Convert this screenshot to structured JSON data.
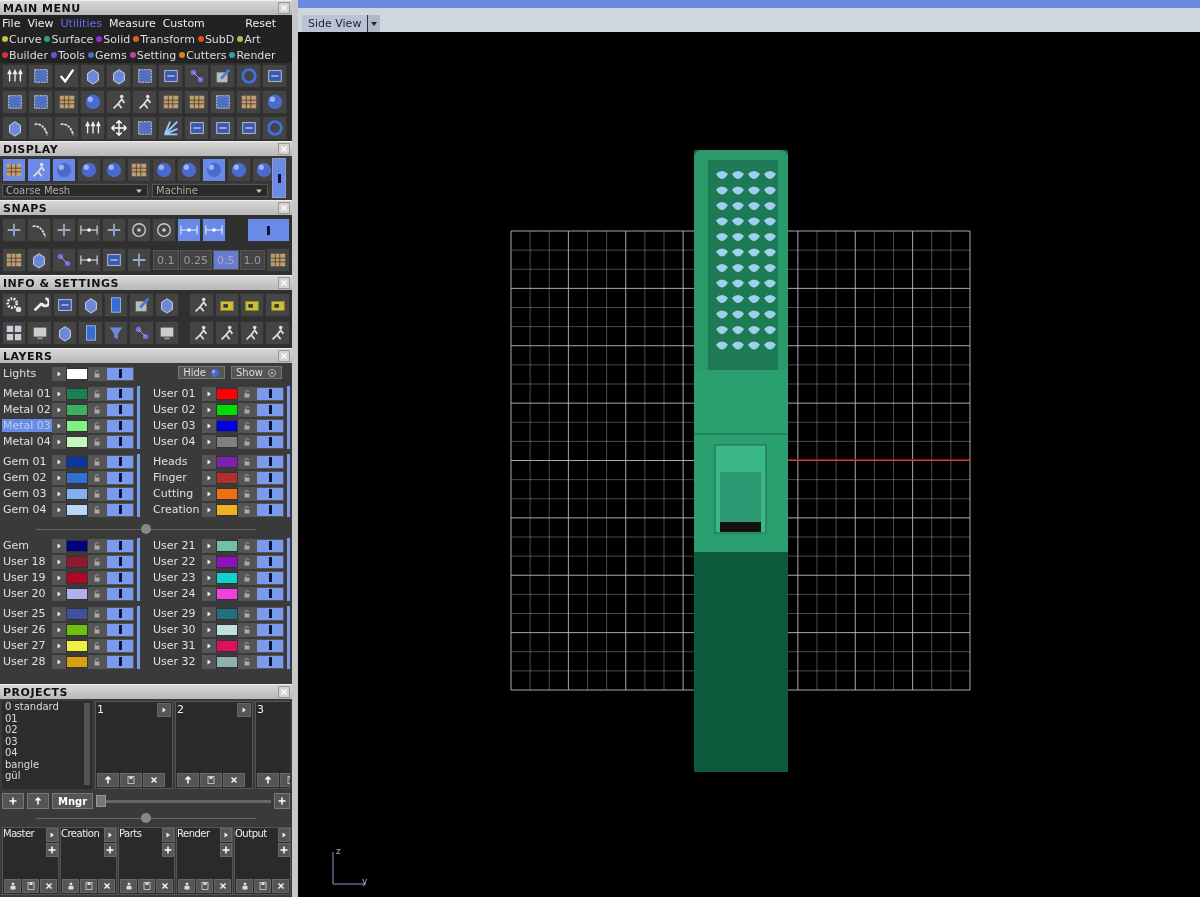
{
  "main_menu": {
    "title": "MAIN MENU",
    "menu": [
      {
        "label": "File",
        "selected": false
      },
      {
        "label": "View",
        "selected": false
      },
      {
        "label": "Utilities",
        "selected": true
      },
      {
        "label": "Measure",
        "selected": false
      },
      {
        "label": "Custom",
        "selected": false
      }
    ],
    "reset": "Reset",
    "categories": [
      [
        {
          "label": "Curve",
          "color": "#c8c040"
        },
        {
          "label": "Surface",
          "color": "#30a070"
        },
        {
          "label": "Solid",
          "color": "#9030d0"
        },
        {
          "label": "Transform",
          "color": "#e06020"
        },
        {
          "label": "SubD",
          "color": "#e05020"
        },
        {
          "label": "Art",
          "color": "#b0c040"
        }
      ],
      [
        {
          "label": "Builder",
          "color": "#d03040"
        },
        {
          "label": "Tools",
          "color": "#7050d0"
        },
        {
          "label": "Gems",
          "color": "#4070c0"
        },
        {
          "label": "Setting",
          "color": "#c040b0"
        },
        {
          "label": "Cutters",
          "color": "#e08020"
        },
        {
          "label": "Render",
          "color": "#30a0a0"
        }
      ]
    ]
  },
  "display": {
    "title": "DISPLAY",
    "mesh": "Coarse Mesh",
    "material": "Machine"
  },
  "snaps": {
    "title": "SNAPS",
    "toggles": [
      {
        "on": false
      },
      {
        "on": false
      },
      {
        "on": false
      },
      {
        "on": false
      },
      {
        "on": false
      },
      {
        "on": false
      },
      {
        "on": false
      },
      {
        "on": true
      },
      {
        "on": true
      }
    ],
    "increments": [
      {
        "label": "0.1",
        "selected": false
      },
      {
        "label": "0.25",
        "selected": false
      },
      {
        "label": "0.5",
        "selected": true
      },
      {
        "label": "1.0",
        "selected": false
      }
    ]
  },
  "info": {
    "title": "INFO & SETTINGS"
  },
  "layers": {
    "title": "LAYERS",
    "lights": {
      "name": "Lights",
      "color": "#ffffff",
      "selected": false,
      "visible": true
    },
    "hide": "Hide",
    "show": "Show",
    "sections": [
      [
        {
          "left": [
            {
              "name": "Metal 01",
              "color": "#1a8050",
              "selected": false,
              "visible": true
            },
            {
              "name": "Metal 02",
              "color": "#3cb060",
              "selected": false,
              "visible": true
            },
            {
              "name": "Metal 03",
              "color": "#80f080",
              "selected": true,
              "visible": true
            },
            {
              "name": "Metal 04",
              "color": "#c0f8c0",
              "selected": false,
              "visible": true
            }
          ],
          "right": [
            {
              "name": "User 01",
              "color": "#ff0000",
              "selected": false,
              "visible": true
            },
            {
              "name": "User 02",
              "color": "#00e000",
              "selected": false,
              "visible": true
            },
            {
              "name": "User 03",
              "color": "#0000e0",
              "selected": false,
              "visible": true
            },
            {
              "name": "User 04",
              "color": "#808080",
              "selected": false,
              "visible": true
            }
          ]
        },
        {
          "left": [
            {
              "name": "Gem 01",
              "color": "#0838a0",
              "selected": false,
              "visible": true
            },
            {
              "name": "Gem 02",
              "color": "#3070d0",
              "selected": false,
              "visible": true
            },
            {
              "name": "Gem 03",
              "color": "#80b0f0",
              "selected": false,
              "visible": true
            },
            {
              "name": "Gem 04",
              "color": "#b8d8f8",
              "selected": false,
              "visible": true
            }
          ],
          "right": [
            {
              "name": "Heads",
              "color": "#8020b0",
              "selected": false,
              "visible": true
            },
            {
              "name": "Finger",
              "color": "#b03030",
              "selected": false,
              "visible": true
            },
            {
              "name": "Cutting",
              "color": "#f07010",
              "selected": false,
              "visible": true
            },
            {
              "name": "Creation",
              "color": "#f0b020",
              "selected": false,
              "visible": true
            }
          ]
        }
      ],
      [
        {
          "left": [
            {
              "name": "Gem",
              "color": "#000080",
              "selected": false,
              "visible": true
            },
            {
              "name": "User 18",
              "color": "#901830",
              "selected": false,
              "visible": true
            },
            {
              "name": "User 19",
              "color": "#b00820",
              "selected": false,
              "visible": true
            },
            {
              "name": "User 20",
              "color": "#b0b0f0",
              "selected": false,
              "visible": true
            }
          ],
          "right": [
            {
              "name": "User 21",
              "color": "#70c0a8",
              "selected": false,
              "visible": true
            },
            {
              "name": "User 22",
              "color": "#9010c0",
              "selected": false,
              "visible": true
            },
            {
              "name": "User 23",
              "color": "#10d0d0",
              "selected": false,
              "visible": true
            },
            {
              "name": "User 24",
              "color": "#f040e0",
              "selected": false,
              "visible": true
            }
          ]
        },
        {
          "left": [
            {
              "name": "User 25",
              "color": "#4050a0",
              "selected": false,
              "visible": true
            },
            {
              "name": "User 26",
              "color": "#70c010",
              "selected": false,
              "visible": true
            },
            {
              "name": "User 27",
              "color": "#f0f040",
              "selected": false,
              "visible": true
            },
            {
              "name": "User 28",
              "color": "#d8a010",
              "selected": false,
              "visible": true
            }
          ],
          "right": [
            {
              "name": "User 29",
              "color": "#207080",
              "selected": false,
              "visible": true
            },
            {
              "name": "User 30",
              "color": "#c0e0e0",
              "selected": false,
              "visible": true
            },
            {
              "name": "User 31",
              "color": "#e01060",
              "selected": false,
              "visible": true
            },
            {
              "name": "User 32",
              "color": "#90b0b0",
              "selected": false,
              "visible": true
            }
          ]
        }
      ]
    ]
  },
  "projects": {
    "title": "PROJECTS",
    "list": [
      {
        "label": "0 standard",
        "selected": false
      },
      {
        "label": "01",
        "selected": false
      },
      {
        "label": "02",
        "selected": false
      },
      {
        "label": "03",
        "selected": false
      },
      {
        "label": "04",
        "selected": false
      },
      {
        "label": "bangle",
        "selected": false
      },
      {
        "label": "gül",
        "selected": false
      }
    ],
    "mngr": "Mngr",
    "slots": [
      "1",
      "2",
      "3"
    ],
    "folders": [
      "Master",
      "Creation",
      "Parts",
      "Render",
      "Output"
    ]
  },
  "viewport": {
    "tab": "Side View",
    "axes": [
      "z",
      "y"
    ]
  }
}
